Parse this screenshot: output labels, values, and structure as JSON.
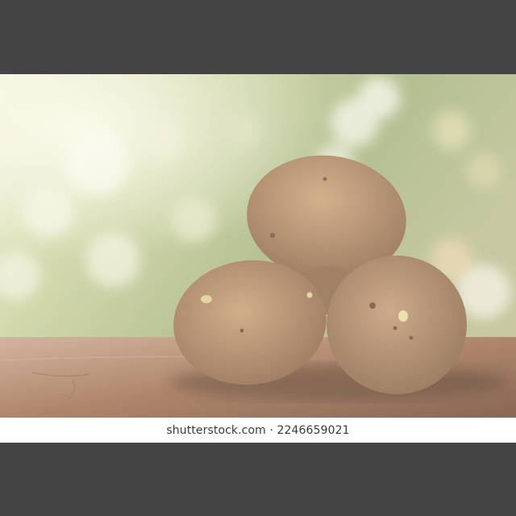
{
  "watermark": {
    "text": "shutterstock.com · 2246659021"
  },
  "photo": {
    "subject": "stacked potatoes on wooden table",
    "colors": {
      "background_light": "#eef0d6",
      "background_green": "#9fae6e",
      "table": "#7a5238",
      "potato": "#b68a5c",
      "frame": "#444444"
    }
  }
}
